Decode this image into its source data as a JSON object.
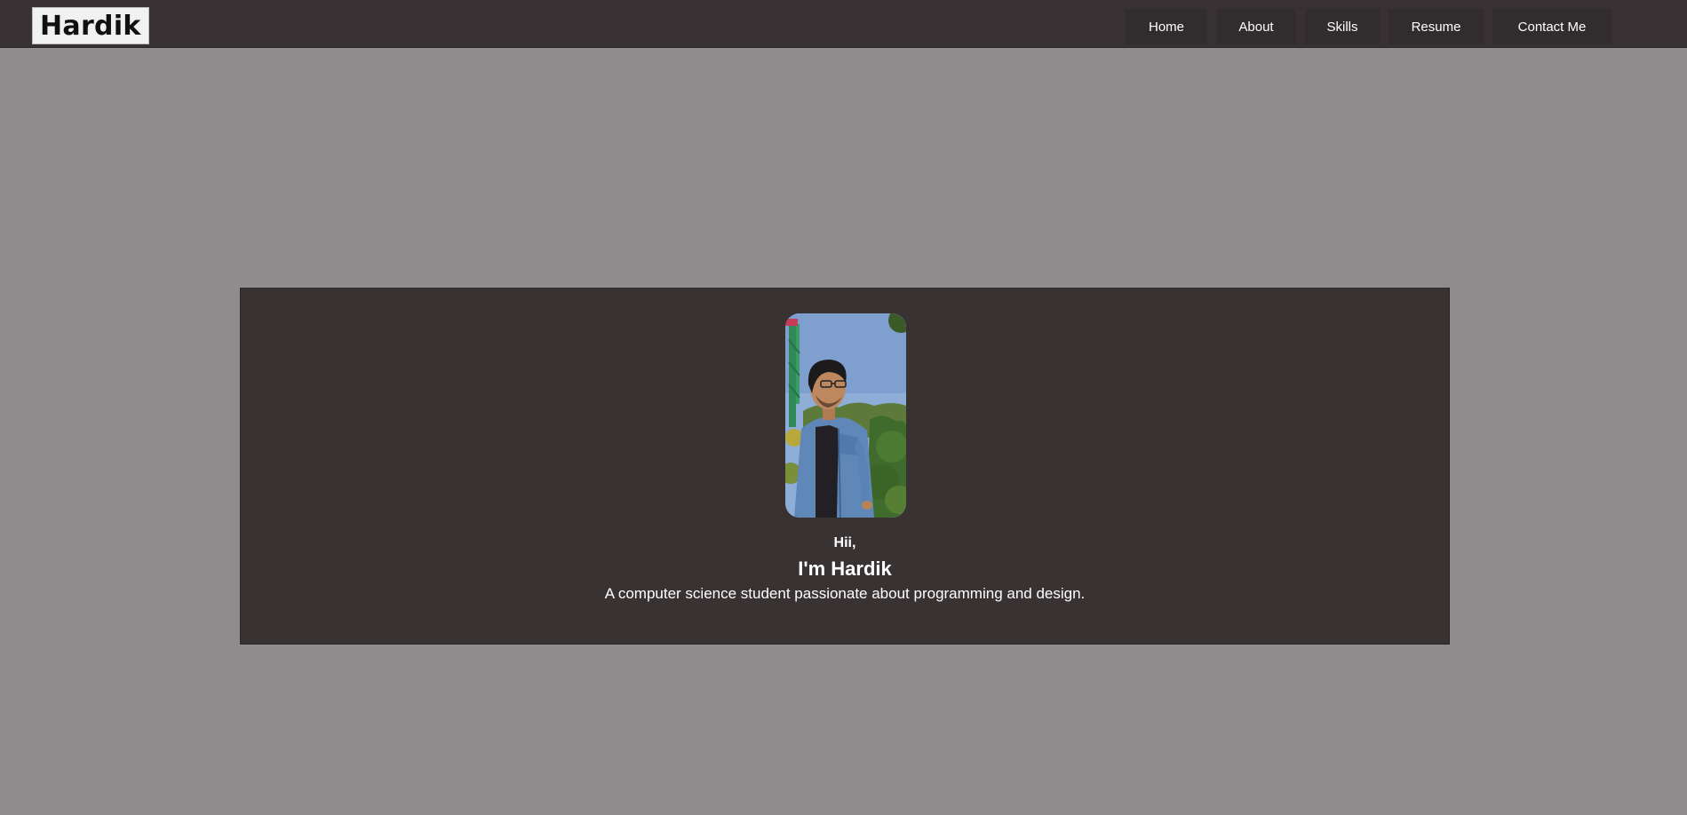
{
  "header": {
    "logo_text": "Hardik",
    "nav": [
      {
        "label": "Home"
      },
      {
        "label": "About"
      },
      {
        "label": "Skills"
      },
      {
        "label": "Resume"
      },
      {
        "label": "Contact Me"
      }
    ]
  },
  "hero": {
    "greeting": "Hii,",
    "name_line": "I'm Hardik",
    "tagline": "A computer science student passionate about programming and design."
  },
  "colors": {
    "page_background": "#8e8c8d",
    "header_background": "#373133",
    "hero_background": "#383233",
    "text": "#ffffff"
  }
}
